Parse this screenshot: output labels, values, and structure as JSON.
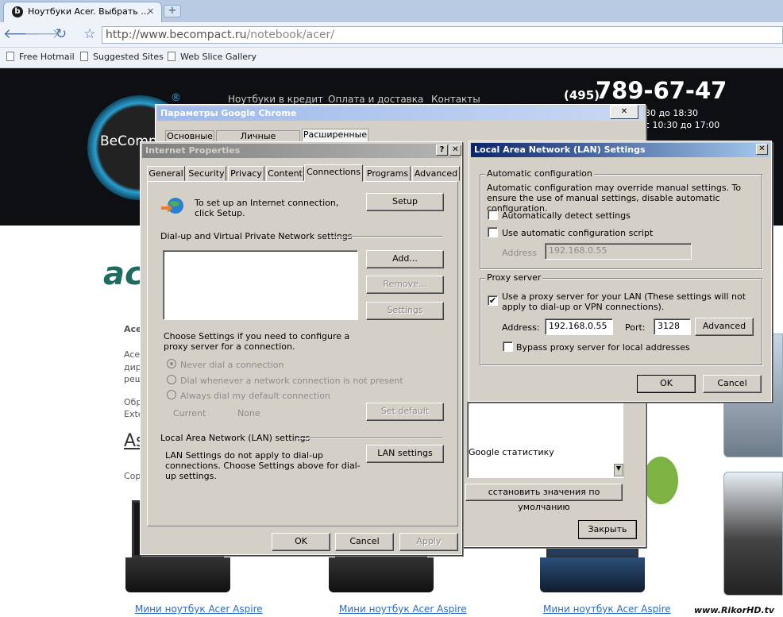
{
  "browser": {
    "tab_title": "Ноутбуки Acer. Выбрать ...",
    "tab_close": "✕",
    "new_tab": "+",
    "url_host": "http://www.becompact.ru",
    "url_path": "/notebook/acer/",
    "bookmarks": [
      "Free Hotmail",
      "Suggested Sites",
      "Web Slice Gallery"
    ]
  },
  "site": {
    "logo": "BeComp",
    "reg_mark": "®",
    "nav": [
      "Ноутбуки в кредит",
      "Оплата и доставка",
      "Контакты"
    ],
    "phone_code": "(495)",
    "phone": "789-67-47",
    "hours": [
      "30 до 18:30",
      "с 10:30 до 17:00"
    ],
    "acer_logo": "ac",
    "bg_lines": [
      "Ace",
      "Ace",
      "дир",
      "реш",
      "Обр",
      "Exte",
      "Сор"
    ],
    "heading": "As",
    "products": [
      "Мини ноутбук Acer Aspire",
      "Мини ноутбук Acer Aspire",
      "Мини ноутбук Acer Aspire"
    ],
    "watermark": "www.RikorHD.tv"
  },
  "chrome_options": {
    "title": "Параметры Google Chrome",
    "tabs": [
      "Основные",
      "Личные материалы",
      "Расширенные"
    ],
    "stats_text": "Google статистику",
    "reset_button": "сстановить значения по умолчанию",
    "close_button": "Закрыть"
  },
  "internet_properties": {
    "title": "Internet Properties",
    "help": "?",
    "close": "✕",
    "tabs": [
      "General",
      "Security",
      "Privacy",
      "Content",
      "Connections",
      "Programs",
      "Advanced"
    ],
    "setup_text": "To set up an Internet connection, click Setup.",
    "setup_button": "Setup",
    "dialup_header": "Dial-up and Virtual Private Network settings",
    "add_button": "Add...",
    "remove_button": "Remove...",
    "settings_button": "Settings",
    "proxy_hint": "Choose Settings if you need to configure a proxy server for a connection.",
    "radios": [
      "Never dial a connection",
      "Dial whenever a network connection is not present",
      "Always dial my default connection"
    ],
    "current_label": "Current",
    "current_value": "None",
    "set_default_button": "Set default",
    "lan_header": "Local Area Network (LAN) settings",
    "lan_text": "LAN Settings do not apply to dial-up connections. Choose Settings above for dial-up settings.",
    "lan_button": "LAN settings",
    "ok": "OK",
    "cancel": "Cancel",
    "apply": "Apply"
  },
  "lan_settings": {
    "title": "Local Area Network (LAN) Settings",
    "close": "✕",
    "auto_group": "Automatic configuration",
    "auto_text": "Automatic configuration may override manual settings.  To ensure the use of manual settings, disable automatic configuration.",
    "auto_detect": "Automatically detect settings",
    "auto_script": "Use automatic configuration script",
    "address_label": "Address",
    "address_value": "192.168.0.55",
    "proxy_group": "Proxy server",
    "use_proxy": "Use a proxy server for your LAN (These settings will not apply to dial-up or VPN connections).",
    "proxy_address_label": "Address:",
    "proxy_address_value": "192.168.0.55",
    "port_label": "Port:",
    "port_value": "3128",
    "advanced_button": "Advanced",
    "bypass": "Bypass proxy server for local addresses",
    "ok": "OK",
    "cancel": "Cancel",
    "checks": {
      "auto_detect": false,
      "auto_script": false,
      "use_proxy": true,
      "bypass": false
    },
    "check_mark": "✔"
  }
}
